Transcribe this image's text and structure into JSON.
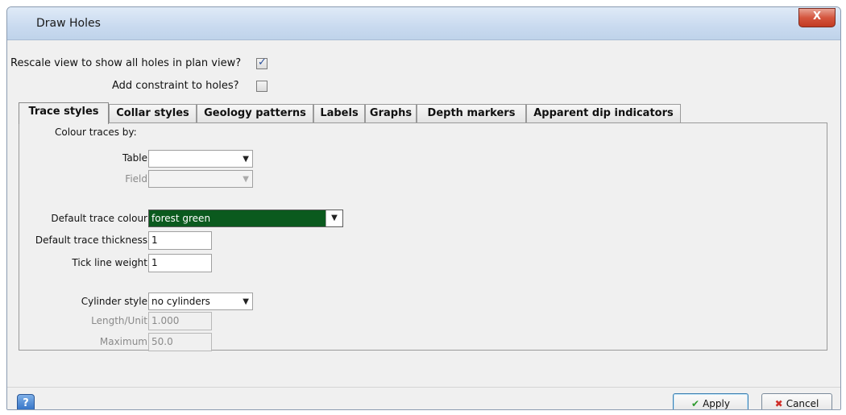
{
  "window": {
    "title": "Draw Holes",
    "close_label": "X"
  },
  "options": {
    "rescale_label": "Rescale view to show all holes in plan view?",
    "rescale_checked": true,
    "constraint_label": "Add constraint to holes?",
    "constraint_checked": false
  },
  "tabs": [
    {
      "label": "Trace styles",
      "active": true
    },
    {
      "label": "Collar styles"
    },
    {
      "label": "Geology patterns"
    },
    {
      "label": "Labels"
    },
    {
      "label": "Graphs"
    },
    {
      "label": "Depth markers"
    },
    {
      "label": "Apparent dip indicators"
    }
  ],
  "trace": {
    "colour_by_heading": "Colour traces by:",
    "table_label": "Table",
    "table_value": "",
    "field_label": "Field",
    "field_value": "",
    "default_colour_label": "Default trace colour",
    "default_colour_value": "forest green",
    "default_colour_hex": "#0b5a1e",
    "thickness_label": "Default trace thickness",
    "thickness_value": "1",
    "tick_weight_label": "Tick line weight",
    "tick_weight_value": "1",
    "cylinder_label": "Cylinder style",
    "cylinder_value": "no cylinders",
    "length_label": "Length/Unit",
    "length_value": "1.000",
    "maximum_label": "Maximum",
    "maximum_value": "50.0"
  },
  "footer": {
    "help_label": "?",
    "apply_label": "Apply",
    "cancel_label": "Cancel"
  }
}
